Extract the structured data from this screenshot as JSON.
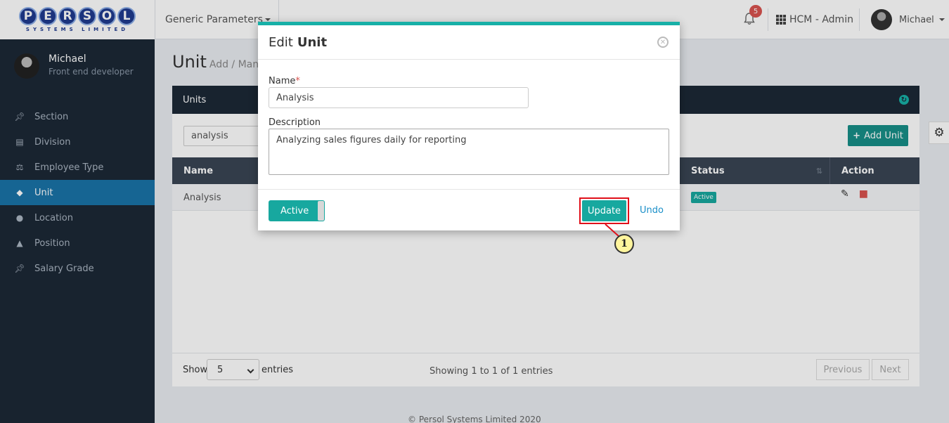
{
  "header": {
    "logo_letters": [
      "P",
      "E",
      "R",
      "S",
      "O",
      "L"
    ],
    "logo_subtitle": "SYSTEMS LIMITED",
    "module_label": "Generic Parameters",
    "notification_count": "5",
    "app_label": "HCM - Admin",
    "user_name": "Michael"
  },
  "sidebar": {
    "profile_name": "Michael",
    "profile_role": "Front end developer",
    "items": [
      {
        "label": "Section",
        "icon": "pin-icon"
      },
      {
        "label": "Division",
        "icon": "building-icon"
      },
      {
        "label": "Employee Type",
        "icon": "balance-scale-icon"
      },
      {
        "label": "Unit",
        "icon": "tag-icon",
        "active": true
      },
      {
        "label": "Location",
        "icon": "map-pin-icon"
      },
      {
        "label": "Position",
        "icon": "graduation-cap-icon"
      },
      {
        "label": "Salary Grade",
        "icon": "pin-icon"
      }
    ]
  },
  "page": {
    "title": "Unit",
    "subtitle": "Add / Manage"
  },
  "panel": {
    "title": "Units",
    "search_value": "analysis",
    "add_button": "Add Unit",
    "columns": {
      "name": "Name",
      "status": "Status",
      "action": "Action"
    },
    "rows": [
      {
        "name": "Analysis",
        "status": "Active"
      }
    ],
    "show_label": "Show",
    "page_size": "5",
    "entries_label": "entries",
    "showing_text": "Showing 1 to 1 of 1 entries",
    "previous_label": "Previous",
    "next_label": "Next"
  },
  "footer": {
    "copyright": "© Persol Systems Limited 2020"
  },
  "modal": {
    "title_prefix": "Edit",
    "title_bold": "Unit",
    "name_label": "Name",
    "required_mark": "*",
    "name_value": "Analysis",
    "description_label": "Description",
    "description_value": "Analyzing sales figures daily for reporting",
    "toggle_label": "Active",
    "update_button": "Update",
    "undo_link": "Undo"
  },
  "annotation": {
    "step_number": "1",
    "highlight_color": "#e0101a"
  },
  "colors": {
    "accent": "#17a89f",
    "sidebar_bg": "#1c2836",
    "active_nav": "#1a74a8"
  }
}
